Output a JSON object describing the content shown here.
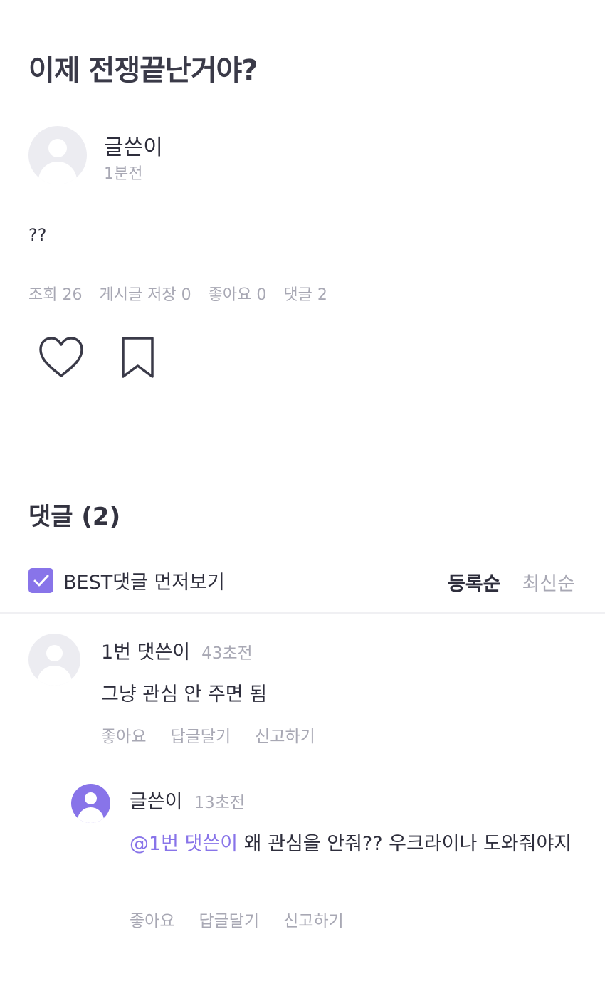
{
  "post": {
    "title": "이제 전쟁끝난거야?",
    "author": "글쓴이",
    "time": "1분전",
    "body": "??",
    "stats": {
      "views": "조회 26",
      "saves": "게시글 저장 0",
      "likes": "좋아요 0",
      "comments": "댓글 2"
    },
    "icons": {
      "like": "heart-outline-icon",
      "save": "bookmark-outline-icon"
    }
  },
  "comments": {
    "header": "댓글 (2)",
    "best_toggle_label": "BEST댓글 먼저보기",
    "best_toggle_checked": true,
    "sort": {
      "active": "등록순",
      "inactive": "최신순"
    },
    "accent_color": "#8874e9",
    "items": [
      {
        "author": "1번 댓쓴이",
        "time": "43초전",
        "text": "그냥 관심 안 주면 됨",
        "actions": [
          "좋아요",
          "답글달기",
          "신고하기"
        ]
      },
      {
        "author": "글쓴이",
        "time": "13초전",
        "mention": "@1번 댓쓴이",
        "text": " 왜 관심을 안줘?? 우크라이나 도와줘야지",
        "actions": [
          "좋아요",
          "답글달기",
          "신고하기"
        ]
      }
    ]
  }
}
